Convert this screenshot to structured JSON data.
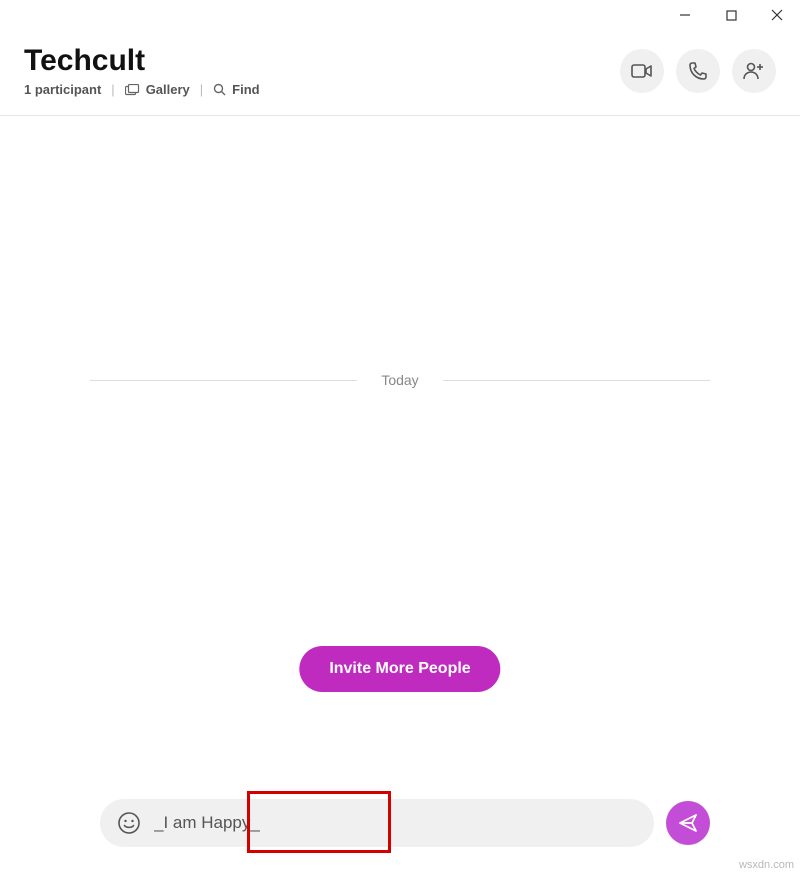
{
  "window": {
    "minimize": "—",
    "maximize": "☐",
    "close": "✕"
  },
  "header": {
    "title": "Techcult",
    "participants": "1 participant",
    "gallery": "Gallery",
    "find": "Find"
  },
  "chat": {
    "date_label": "Today"
  },
  "actions": {
    "invite_label": "Invite More People"
  },
  "composer": {
    "value": "_I am Happy_"
  },
  "watermark": "wsxdn.com"
}
